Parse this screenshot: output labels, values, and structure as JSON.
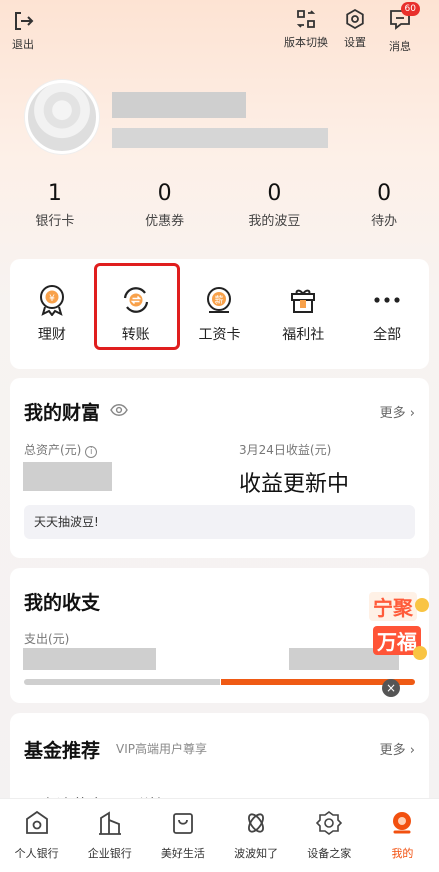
{
  "header": {
    "logout_label": "退出",
    "version_switch_label": "版本切换",
    "settings_label": "设置",
    "messages_label": "消息",
    "messages_badge": "60"
  },
  "stats": [
    {
      "value": "1",
      "label": "银行卡"
    },
    {
      "value": "0",
      "label": "优惠券"
    },
    {
      "value": "0",
      "label": "我的波豆"
    },
    {
      "value": "0",
      "label": "待办"
    }
  ],
  "quick_actions": [
    {
      "label": "理财",
      "icon": "wealth-icon"
    },
    {
      "label": "转账",
      "icon": "transfer-icon"
    },
    {
      "label": "工资卡",
      "icon": "salary-card-icon"
    },
    {
      "label": "福利社",
      "icon": "gift-icon"
    },
    {
      "label": "全部",
      "icon": "more-dots-icon"
    }
  ],
  "wealth": {
    "title": "我的财富",
    "more": "更多",
    "total_assets_label": "总资产(元)",
    "earnings_label": "3月24日收益(元)",
    "earnings_value": "收益更新中",
    "tip": "天天抽波豆!"
  },
  "income": {
    "title": "我的收支",
    "expense_label": "支出(元)",
    "promo_line1": "宁聚",
    "promo_line2": "万福"
  },
  "fund": {
    "title": "基金推荐",
    "subtitle": "VIP高端用户尊享",
    "more": "更多",
    "fund_name": "易方达黄金ETF联接A"
  },
  "tabbar": [
    {
      "label": "个人银行",
      "icon": "personal-bank-icon",
      "active": false
    },
    {
      "label": "企业银行",
      "icon": "enterprise-bank-icon",
      "active": false
    },
    {
      "label": "美好生活",
      "icon": "shopping-bag-icon",
      "active": false
    },
    {
      "label": "波波知了",
      "icon": "knot-icon",
      "active": false
    },
    {
      "label": "设备之家",
      "icon": "device-home-icon",
      "active": false
    },
    {
      "label": "我的",
      "icon": "me-icon",
      "active": true
    }
  ],
  "colors": {
    "accent": "#f2500f",
    "highlight_box": "#e01e1e",
    "badge": "#e8302c"
  }
}
